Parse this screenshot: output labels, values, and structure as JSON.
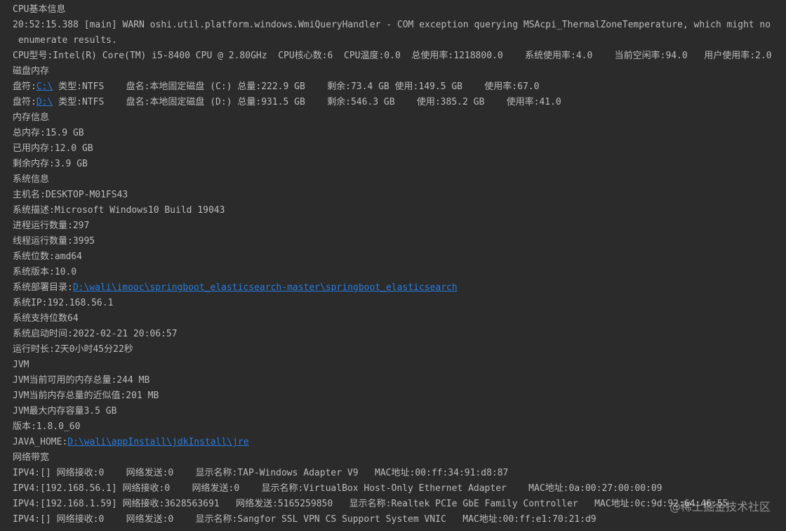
{
  "console": {
    "lines": {
      "cpu_section": "CPU基本信息",
      "warn_1": "20:52:15.388 [main] WARN oshi.util.platform.windows.WmiQueryHandler - COM exception querying MSAcpi_ThermalZoneTemperature, which might no",
      "warn_2": " enumerate results.",
      "cpu_info": "CPU型号:Intel(R) Core(TM) i5-8400 CPU @ 2.80GHz  CPU核心数:6  CPU温度:0.0  总使用率:1218800.0    系统使用率:4.0    当前空闲率:94.0   用户使用率:2.0",
      "disk_section": "磁盘内存",
      "disk_c": {
        "prefix": "盘符:",
        "link": "C:\\",
        "rest": " 类型:NTFS    盘名:本地固定磁盘 (C:) 总量:222.9 GB    剩余:73.4 GB 使用:149.5 GB    使用率:67.0"
      },
      "disk_d": {
        "prefix": "盘符:",
        "link": "D:\\",
        "rest": " 类型:NTFS    盘名:本地固定磁盘 (D:) 总量:931.5 GB    剩余:546.3 GB    使用:385.2 GB    使用率:41.0"
      },
      "mem_section": "内存信息",
      "mem_total": "总内存:15.9 GB",
      "mem_used": "已用内存:12.0 GB",
      "mem_free": "剩余内存:3.9 GB",
      "sys_section": "系统信息",
      "hostname": "主机名:DESKTOP-M01FS43",
      "sys_desc": "系统描述:Microsoft Windows10 Build 19043",
      "proc_count": "进程运行数量:297",
      "thread_count": "线程运行数量:3995",
      "sys_arch": "系统位数:amd64",
      "sys_version": "系统版本:10.0",
      "deploy_dir": {
        "prefix": "系统部署目录:",
        "link": "D:\\wali\\imooc\\springboot_elasticsearch-master\\springboot_elasticsearch"
      },
      "sys_ip": "系统IP:192.168.56.1",
      "sys_bits": "系统支持位数64",
      "boot_time": "系统启动时间:2022-02-21 20:06:57",
      "uptime": "运行时长:2天0小时45分22秒",
      "jvm_section": "JVM",
      "jvm_avail": "JVM当前可用的内存总量:244 MB",
      "jvm_total": "JVM当前内存总量的近似值:201 MB",
      "jvm_max": "JVM最大内存容量3.5 GB",
      "java_version": "版本:1.8.0_60",
      "java_home": {
        "prefix": "JAVA_HOME:",
        "link": "D:\\wali\\appInstall\\jdkInstall\\jre"
      },
      "net_section": "网络带宽",
      "net_1": "IPV4:[] 网络接收:0    网络发送:0    显示名称:TAP-Windows Adapter V9   MAC地址:00:ff:34:91:d8:87",
      "net_2": "IPV4:[192.168.56.1] 网络接收:0    网络发送:0    显示名称:VirtualBox Host-Only Ethernet Adapter    MAC地址:0a:00:27:00:00:09",
      "net_3": "IPV4:[192.168.1.59] 网络接收:3628563691   网络发送:5165259850   显示名称:Realtek PCIe GbE Family Controller   MAC地址:0c:9d:92:64:46:55",
      "net_4": "IPV4:[] 网络接收:0    网络发送:0    显示名称:Sangfor SSL VPN CS Support System VNIC   MAC地址:00:ff:e1:70:21:d9"
    }
  },
  "watermark": "@稀土掘金技术社区",
  "colors": {
    "background": "#2b2b2b",
    "text": "#bbbbbb",
    "link": "#287bde"
  }
}
